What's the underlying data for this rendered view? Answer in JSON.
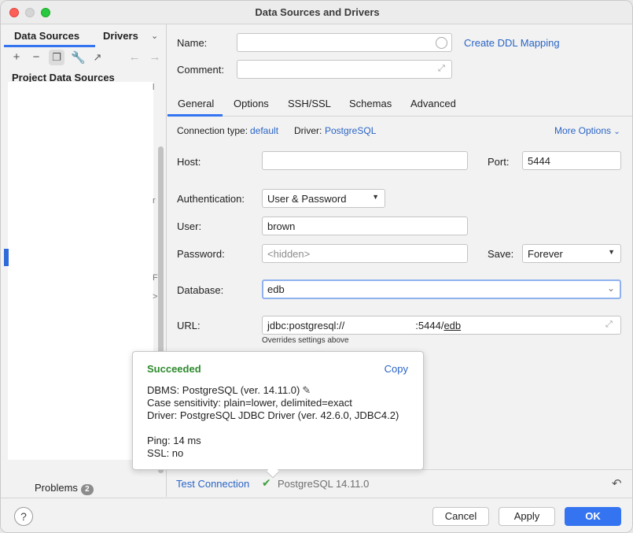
{
  "window": {
    "title": "Data Sources and Drivers"
  },
  "left_panel": {
    "tabs": [
      "Data Sources",
      "Drivers"
    ],
    "section_title": "Project Data Sources",
    "problems_label": "Problems",
    "problems_count": "2",
    "clipped_fragments": [
      "l",
      "r",
      "F",
      ">"
    ]
  },
  "form": {
    "name_label": "Name:",
    "name_value": "",
    "create_ddl_link": "Create DDL Mapping",
    "comment_label": "Comment:",
    "comment_value": "",
    "tabs": [
      "General",
      "Options",
      "SSH/SSL",
      "Schemas",
      "Advanced"
    ],
    "active_tab": "General",
    "connection_type_label": "Connection type:",
    "connection_type_value": "default",
    "driver_label": "Driver:",
    "driver_value": "PostgreSQL",
    "more_options": "More Options",
    "host_label": "Host:",
    "host_value": "",
    "port_label": "Port:",
    "port_value": "5444",
    "auth_label": "Authentication:",
    "auth_value": "User & Password",
    "user_label": "User:",
    "user_value": "brown",
    "password_label": "Password:",
    "password_placeholder": "<hidden>",
    "save_label": "Save:",
    "save_value": "Forever",
    "database_label": "Database:",
    "database_value": "edb",
    "url_label": "URL:",
    "url_prefix": "jdbc:postgresql://",
    "url_port": ":5444/",
    "url_db": "edb",
    "url_hint": "Overrides settings above",
    "test_connection": "Test Connection",
    "test_result": "PostgreSQL 14.11.0"
  },
  "popup": {
    "title": "Succeeded",
    "copy_link": "Copy",
    "dbms": "DBMS: PostgreSQL (ver. 14.11.0)",
    "case_sensitivity": "Case sensitivity: plain=lower, delimited=exact",
    "driver": "Driver: PostgreSQL JDBC Driver (ver. 42.6.0, JDBC4.2)",
    "ping": "Ping: 14 ms",
    "ssl": "SSL: no"
  },
  "footer": {
    "help": "?",
    "cancel": "Cancel",
    "apply": "Apply",
    "ok": "OK"
  },
  "colors": {
    "accent": "#3574f0",
    "link": "#2a64c6",
    "success": "#2d8a2d"
  }
}
